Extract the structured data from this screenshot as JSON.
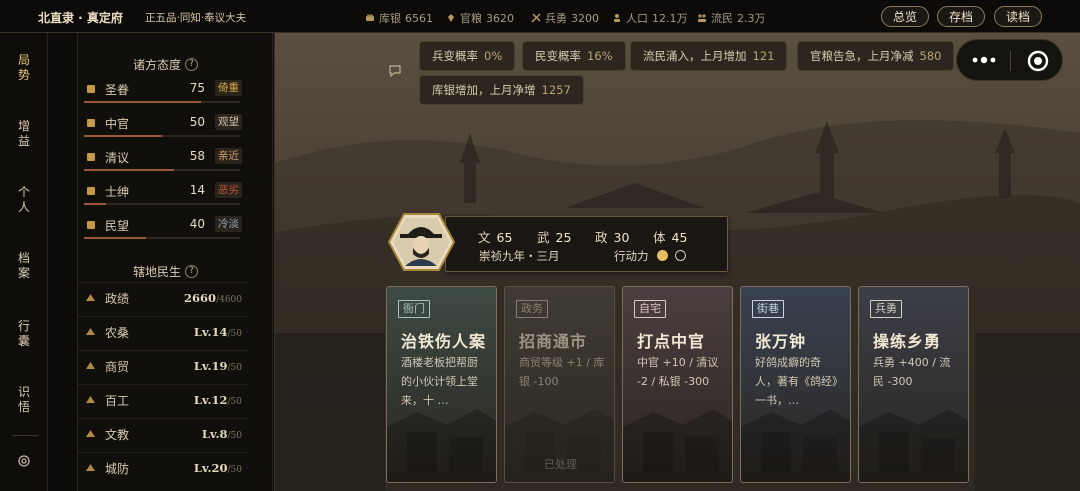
{
  "topbar": {
    "location": "北直隶 · 真定府",
    "rank": "正五品·同知·奉议大夫",
    "resources": [
      {
        "label": "库银",
        "value": "6561",
        "icon": "silver-icon"
      },
      {
        "label": "官粮",
        "value": "3620",
        "icon": "grain-icon"
      },
      {
        "label": "兵勇",
        "value": "3200",
        "icon": "soldier-icon"
      },
      {
        "label": "人口",
        "value": "12.1万",
        "icon": "population-icon"
      },
      {
        "label": "流民",
        "value": "2.3万",
        "icon": "refugee-icon"
      }
    ],
    "buttons": {
      "overview": "总览",
      "save": "存档",
      "load": "读档"
    }
  },
  "nav": {
    "items": [
      {
        "label": "局\n势",
        "active": true
      },
      {
        "label": "增\n益",
        "active": false
      },
      {
        "label": "个\n人",
        "active": false
      },
      {
        "label": "档\n案",
        "active": false
      },
      {
        "label": "行\n囊",
        "active": false
      },
      {
        "label": "识\n悟",
        "active": false
      }
    ]
  },
  "factions": {
    "title": "诸方态度",
    "help": "?",
    "items": [
      {
        "name": "圣眷",
        "value": "75",
        "tag": "倚重",
        "tag_color": "#d9a84a",
        "fill": 0.75,
        "icon": "emperor-icon"
      },
      {
        "name": "中官",
        "value": "50",
        "tag": "观望",
        "tag_color": "#c9bfa9",
        "fill": 0.5,
        "icon": "eunuch-icon"
      },
      {
        "name": "清议",
        "value": "58",
        "tag": "亲近",
        "tag_color": "#cfa070",
        "fill": 0.58,
        "icon": "scholar-icon"
      },
      {
        "name": "士绅",
        "value": "14",
        "tag": "恶劣",
        "tag_color": "#c0503c",
        "fill": 0.14,
        "icon": "gentry-icon"
      },
      {
        "name": "民望",
        "value": "40",
        "tag": "冷淡",
        "tag_color": "#8fa6b8",
        "fill": 0.4,
        "icon": "people-icon"
      }
    ]
  },
  "domain_stats": {
    "title": "辖地民生",
    "help": "?",
    "items": [
      {
        "name": "政绩",
        "value": "2660",
        "max": "/4600",
        "icon": "merit-icon"
      },
      {
        "name": "农桑",
        "value": "Lv.14",
        "max": "/50",
        "icon": "farming-icon"
      },
      {
        "name": "商贸",
        "value": "Lv.19",
        "max": "/50",
        "icon": "trade-icon"
      },
      {
        "name": "百工",
        "value": "Lv.12",
        "max": "/50",
        "icon": "craft-icon"
      },
      {
        "name": "文教",
        "value": "Lv.8",
        "max": "/50",
        "icon": "education-icon"
      },
      {
        "name": "城防",
        "value": "Lv.20",
        "max": "/50",
        "icon": "defense-icon"
      }
    ]
  },
  "chips": [
    {
      "label": "兵变概率",
      "value": "0%"
    },
    {
      "label": "民变概率",
      "value": "16%"
    },
    {
      "label": "流民涌入，上月增加",
      "value": "121"
    },
    {
      "label": "官粮告急，上月净减",
      "value": "580"
    },
    {
      "label": "库银增加，上月净增",
      "value": "1257"
    }
  ],
  "character": {
    "attrs": [
      {
        "label": "文",
        "value": "65"
      },
      {
        "label": "武",
        "value": "25"
      },
      {
        "label": "政",
        "value": "30"
      },
      {
        "label": "体",
        "value": "45"
      }
    ],
    "date": "崇祯九年・三月",
    "action_label": "行动力",
    "action_points_filled": 1,
    "action_points_total": 2
  },
  "cards": [
    {
      "tag": "衙门",
      "title": "治铁伤人案",
      "desc": "酒楼老板把帮厨的小伙计领上堂来，十 …",
      "done": "",
      "tag_color": "#a9c4b8",
      "bg": "#3e4a44",
      "dim": false
    },
    {
      "tag": "政务",
      "title": "招商通市",
      "desc": "商贸等级 +1 / 库银 -100",
      "done": "已处理",
      "tag_color": "#c9c0ad",
      "bg": "#4a4740",
      "dim": true
    },
    {
      "tag": "自宅",
      "title": "打点中官",
      "desc": "中官 +10 / 清议 -2 / 私银 -300",
      "done": "",
      "tag_color": "#e0c5c4",
      "bg": "#4c3e40",
      "dim": false
    },
    {
      "tag": "街巷",
      "title": "张万钟",
      "desc": "好鸽成癖的奇人，著有《鸽经》一书，…",
      "done": "",
      "tag_color": "#c8d3e3",
      "bg": "#394252",
      "dim": false
    },
    {
      "tag": "兵勇",
      "title": "操练乡勇",
      "desc": "兵勇 +400 / 流民 -300",
      "done": "",
      "tag_color": "#d6cfbf",
      "bg": "#3c3f48",
      "dim": false
    }
  ]
}
